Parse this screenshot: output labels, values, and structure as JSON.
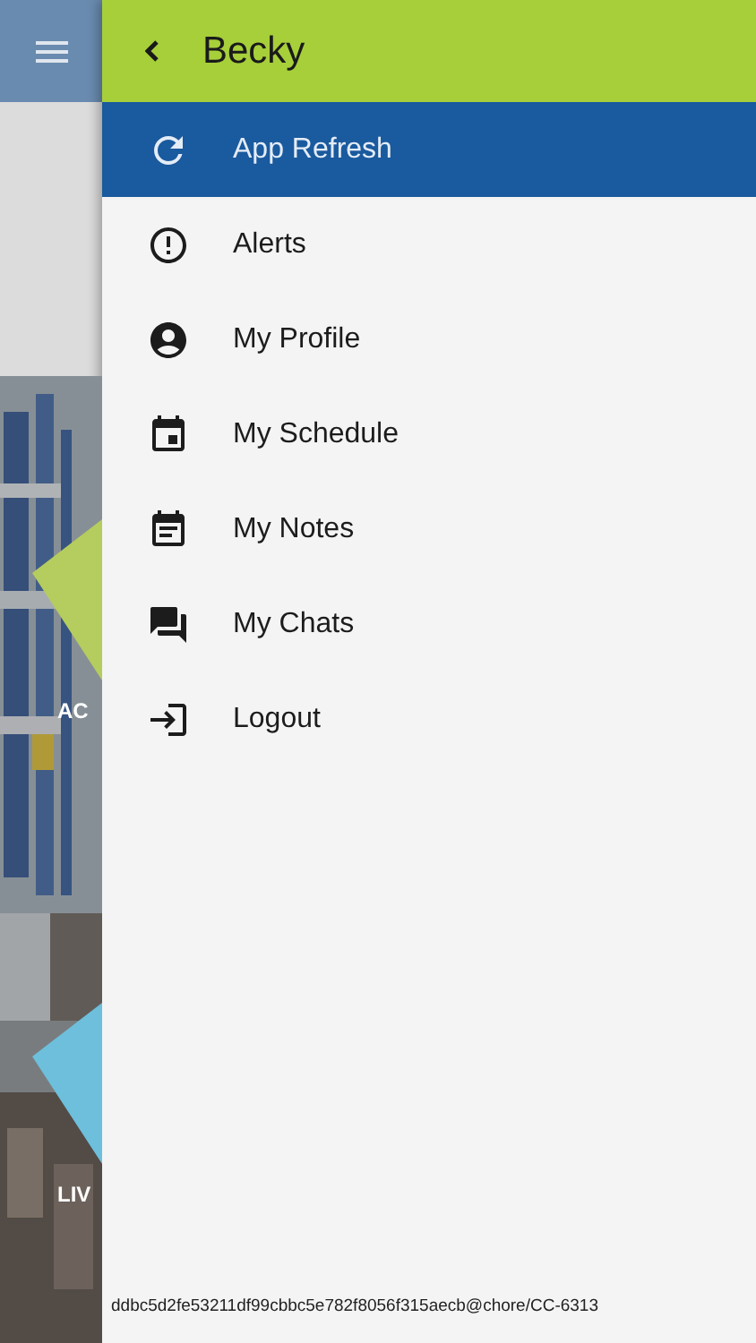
{
  "background": {
    "tiles": [
      {
        "label": "AC",
        "color": "#b5cc5e"
      },
      {
        "label": "LIV",
        "color": "#6dbfdc"
      }
    ]
  },
  "drawer": {
    "title": "Becky",
    "items": [
      {
        "label": "App Refresh",
        "selected": true
      },
      {
        "label": "Alerts",
        "selected": false
      },
      {
        "label": "My Profile",
        "selected": false
      },
      {
        "label": "My Schedule",
        "selected": false
      },
      {
        "label": "My Notes",
        "selected": false
      },
      {
        "label": "My Chats",
        "selected": false
      },
      {
        "label": "Logout",
        "selected": false
      }
    ],
    "footer": "ddbc5d2fe53211df99cbbc5e782f8056f315aecb@chore/CC-6313"
  }
}
